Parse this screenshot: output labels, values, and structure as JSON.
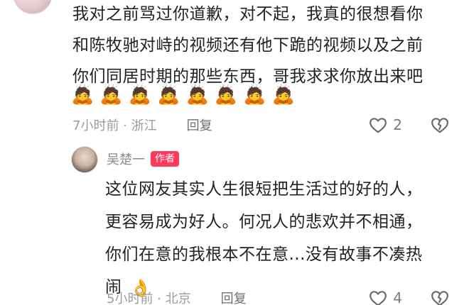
{
  "top_comment": {
    "lines": [
      "我对之前骂过你道歉，对不起，我真的很想看你",
      "和陈牧驰对峙的视频还有他下跪的视频以及之前",
      "你们同居时期的那些东西，哥我求求你放出来吧"
    ],
    "emojis": [
      "🙇",
      "🙇",
      "🙇",
      "🙇",
      "🙇",
      "🙇",
      "🙇",
      "🙇"
    ],
    "meta": {
      "time_location": "7小时前 · 浙江",
      "reply_label": "回复",
      "like_count": "2"
    }
  },
  "reply_comment": {
    "author": "吴楚一",
    "badge": "作者",
    "lines": [
      "这位网友其实人生很短把生活过的好的人，",
      "更容易成为好人。何况人的悲欢并不相通，",
      "你们在意的我根本不在意...没有故事不凑热",
      "闹"
    ],
    "ok_emoji": "👌",
    "meta": {
      "time_location": "5小时前 · 北京",
      "reply_label": "回复",
      "like_count": "4"
    }
  }
}
